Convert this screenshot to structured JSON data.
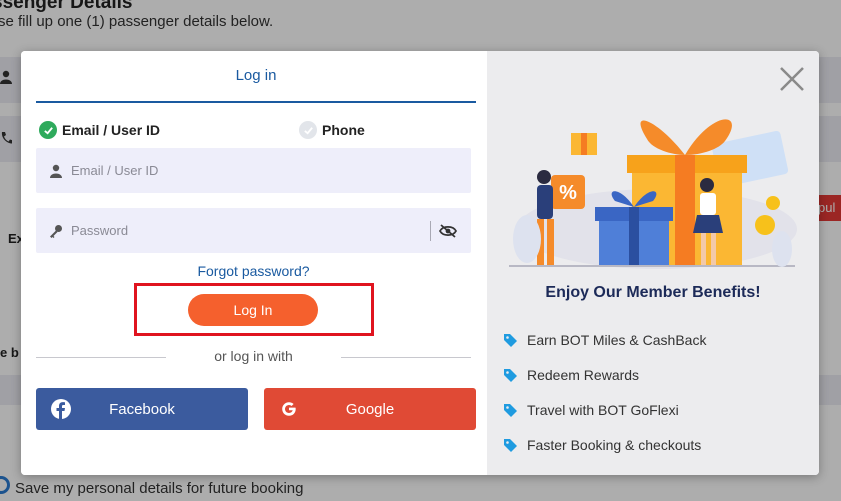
{
  "background": {
    "heading": "ssenger Details",
    "subheading": "se fill up one (1) passenger details below.",
    "ex_text": "Ex",
    "eb_text": "e b",
    "tag_text": "pul",
    "save_text": "Save my personal details for future booking"
  },
  "modal": {
    "tab_login": "Log in",
    "option_email": "Email / User ID",
    "option_phone": "Phone",
    "email_placeholder": "Email / User ID",
    "password_placeholder": "Password",
    "forgot_label": "Forgot password?",
    "login_label": "Log In",
    "or_text": "or log in with",
    "facebook_label": "Facebook",
    "google_label": "Google"
  },
  "promo": {
    "title": "Enjoy Our Member Benefits!",
    "benefits": [
      "Earn BOT Miles & CashBack",
      "Redeem Rewards",
      "Travel with BOT GoFlexi",
      "Faster Booking & checkouts"
    ],
    "percent_sign": "%"
  },
  "colors": {
    "accent_blue": "#1a5aa0",
    "login_orange": "#f5602d",
    "highlight_red": "#e0141f",
    "facebook_blue": "#3b5b9e",
    "google_red": "#e04a35",
    "check_green": "#2eaa5c",
    "tag_blue": "#1f9be0"
  }
}
